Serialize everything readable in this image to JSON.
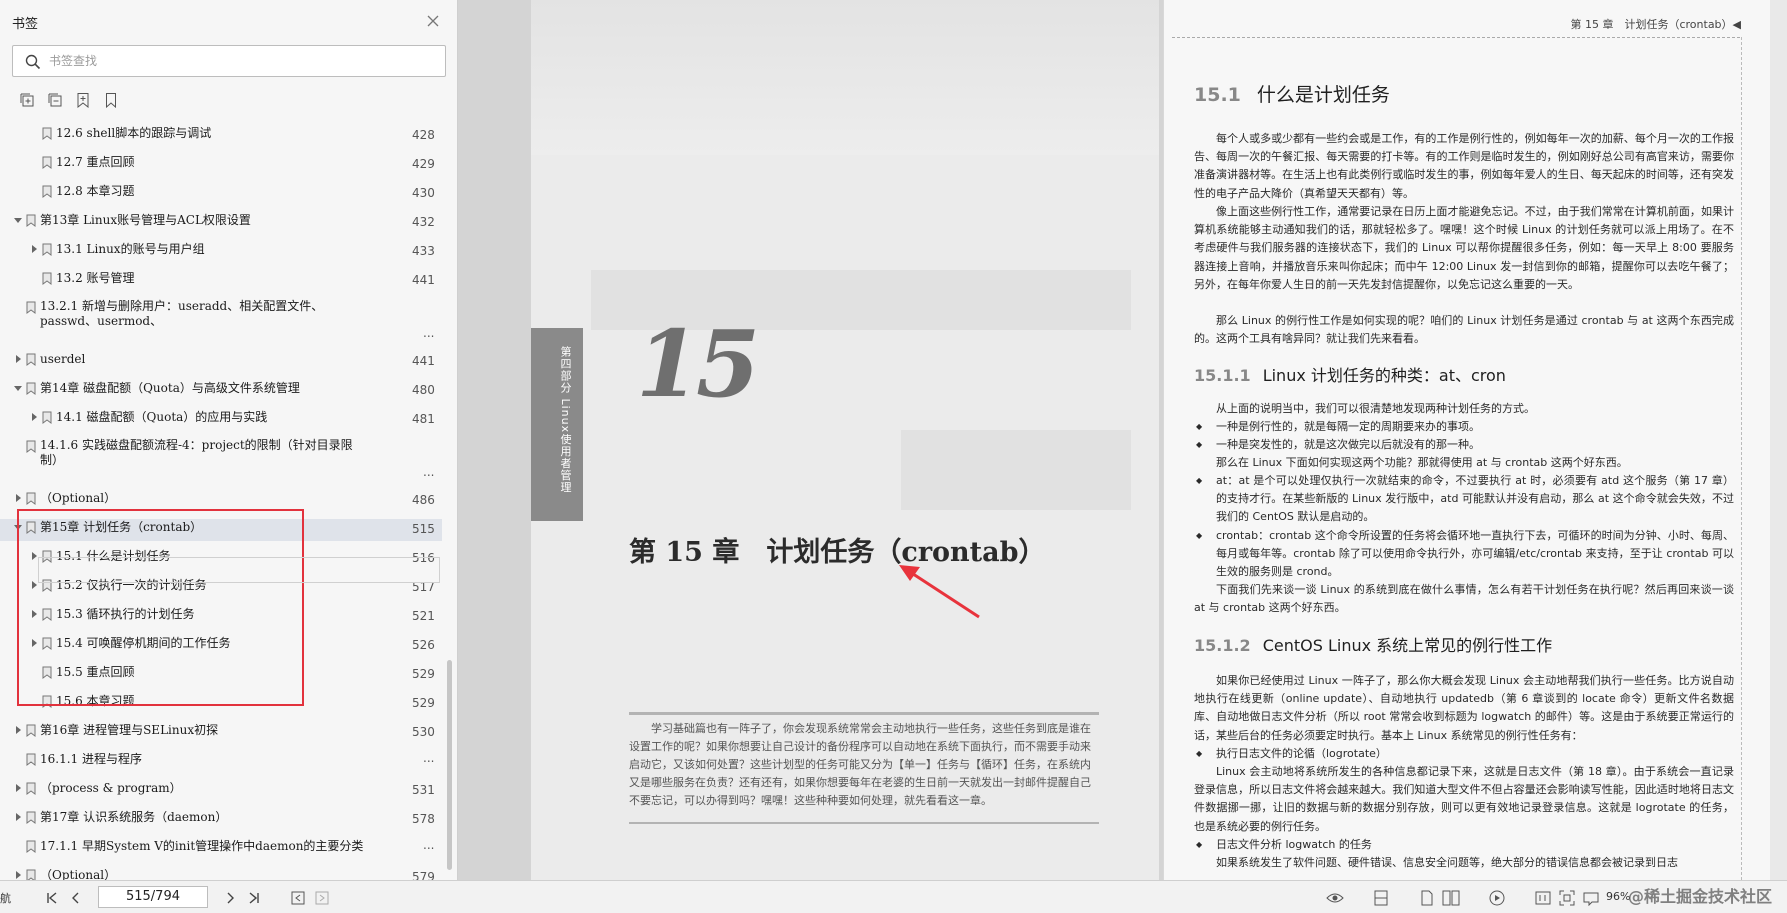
{
  "sidebar": {
    "title": "书签",
    "search_placeholder": "书签查找",
    "tree": [
      {
        "label": "12.6 shell脚本的跟踪与调试",
        "page": "428"
      },
      {
        "label": "12.7 重点回顾",
        "page": "429"
      },
      {
        "label": "12.8 本章习题",
        "page": "430"
      },
      {
        "label": "第13章 Linux账号管理与ACL权限设置",
        "page": "432"
      },
      {
        "label": "13.1 Linux的账号与用户组",
        "page": "433"
      },
      {
        "label": "13.2 账号管理",
        "page": "441"
      },
      {
        "label": "13.2.1 新增与删除用户：useradd、相关配置文件、passwd、usermod、",
        "page": "..."
      },
      {
        "label": "userdel",
        "page": "441"
      },
      {
        "label": "第14章 磁盘配额（Quota）与高级文件系统管理",
        "page": "480"
      },
      {
        "label": "14.1 磁盘配额（Quota）的应用与实践",
        "page": "481"
      },
      {
        "label": "14.1.6 实践磁盘配额流程-4：project的限制（针对目录限制）",
        "page": "..."
      },
      {
        "label": "（Optional）",
        "page": "486"
      },
      {
        "label": "第15章 计划任务（crontab）",
        "page": "515"
      },
      {
        "label": "15.1 什么是计划任务",
        "page": "516"
      },
      {
        "label": "15.2 仅执行一次的计划任务",
        "page": "517"
      },
      {
        "label": "15.3 循环执行的计划任务",
        "page": "521"
      },
      {
        "label": "15.4 可唤醒停机期间的工作任务",
        "page": "526"
      },
      {
        "label": "15.5 重点回顾",
        "page": "529"
      },
      {
        "label": "15.6 本章习题",
        "page": "529"
      },
      {
        "label": "第16章 进程管理与SELinux初探",
        "page": "530"
      },
      {
        "label": "16.1.1 进程与程序",
        "page": "..."
      },
      {
        "label": "（process & program）",
        "page": "531"
      },
      {
        "label": "第17章 认识系统服务（daemon）",
        "page": "578"
      },
      {
        "label": "17.1.1 早期System V的init管理操作中daemon的主要分类",
        "page": "..."
      },
      {
        "label": "（Optional）",
        "page": "579"
      }
    ]
  },
  "left_page": {
    "tab_text": "第四部分 Linux使用者管理",
    "chapter_number": "15",
    "chapter_title": "第 15 章　计划任务（crontab）",
    "intro": "学习基础篇也有一阵子了，你会发现系统常常会主动地执行一些任务，这些任务到底是谁在设置工作的呢？如果你想要让自己设计的备份程序可以自动地在系统下面执行，而不需要手动来启动它，又该如何处置？这些计划型的任务可能又分为【单一】任务与【循环】任务，在系统内又是哪些服务在负责？还有还有，如果你想要每年在老婆的生日前一天就发出一封邮件提醒自己不要忘记，可以办得到吗？嘿嘿！这些种种要如何处理，就先看看这一章。"
  },
  "right_page": {
    "header": "第 15 章　计划任务（crontab）◀",
    "h1_num": "15.1",
    "h1": "什么是计划任务",
    "p1": "每个人或多或少都有一些约会或是工作，有的工作是例行性的，例如每年一次的加薪、每个月一次的工作报告、每周一次的午餐汇报、每天需要的打卡等。有的工作则是临时发生的，例如刚好总公司有高官来访，需要你准备演讲器材等。在生活上也有此类例行或临时发生的事，例如每年爱人的生日、每天起床的时间等，还有突发性的电子产品大降价（真希望天天都有）等。",
    "p2": "像上面这些例行性工作，通常要记录在日历上面才能避免忘记。不过，由于我们常常在计算机前面，如果计算机系统能够主动通知我们的话，那就轻松多了。嘿嘿！这个时候 Linux 的计划任务就可以派上用场了。在不考虑硬件与我们服务器的连接状态下，我们的 Linux 可以帮你提醒很多任务，例如：每一天早上 8:00 要服务器连接上音响，并播放音乐来叫你起床；而中午 12:00 Linux 发一封信到你的邮箱，提醒你可以去吃午餐了；另外，在每年你爱人生日的前一天先发封信提醒你，以免忘记这么重要的一天。",
    "p3": "那么 Linux 的例行性工作是如何实现的呢？咱们的 Linux 计划任务是通过 crontab 与 at 这两个东西完成的。这两个工具有啥异同？就让我们先来看看。",
    "h2a_num": "15.1.1",
    "h2a": "Linux 计划任务的种类：at、cron",
    "p4": "从上面的说明当中，我们可以很清楚地发现两种计划任务的方式。",
    "b1": "一种是例行性的，就是每隔一定的周期要来办的事项。",
    "b2": "一种是突发性的，就是这次做完以后就没有的那一种。",
    "p5": "那么在 Linux 下面如何实现这两个功能？那就得使用 at 与 crontab 这两个好东西。",
    "b3": "at：at 是个可以处理仅执行一次就结束的命令，不过要执行 at 时，必须要有 atd 这个服务（第 17 章）的支持才行。在某些新版的 Linux 发行版中，atd 可能默认并没有启动，那么 at 这个命令就会失效，不过我们的 CentOS 默认是启动的。",
    "b4": "crontab：crontab 这个命令所设置的任务将会循环地一直执行下去，可循环的时间为分钟、小时、每周、每月或每年等。crontab 除了可以使用命令执行外，亦可编辑/etc/crontab 来支持，至于让 crontab 可以生效的服务则是 crond。",
    "p6": "下面我们先来谈一谈 Linux 的系统到底在做什么事情，怎么有若干计划任务在执行呢？然后再回来谈一谈 at 与 crontab 这两个好东西。",
    "h2b_num": "15.1.2",
    "h2b": "CentOS Linux 系统上常见的例行性工作",
    "p7": "如果你已经使用过 Linux 一阵子了，那么你大概会发现 Linux 会主动地帮我们执行一些任务。比方说自动地执行在线更新（online update）、自动地执行 updatedb（第 6 章谈到的 locate 命令）更新文件名数据库、自动地做日志文件分析（所以 root 常常会收到标题为 logwatch 的邮件）等。这是由于系统要正常运行的话，某些后台的任务必须要定时执行。基本上 Linux 系统常见的例行性任务有：",
    "b5": "执行日志文件的论循（logrotate）",
    "p8": "Linux 会主动地将系统所发生的各种信息都记录下来，这就是日志文件（第 18 章）。由于系统会一直记录登录信息，所以日志文件将会越来越大。我们知道大型文件不但占容量还会影响读写性能，因此适时地将日志文件数据挪一挪，让旧的数据与新的数据分别存放，则可以更有效地记录登录信息。这就是 logrotate 的任务，也是系统必要的例行任务。",
    "b6": "日志文件分析 logwatch 的任务",
    "p9": "如果系统发生了软件问题、硬件错误、信息安全问题等，绝大部分的错误信息都会被记录到日志"
  },
  "statusbar": {
    "left_text": "航",
    "page_field": "515/794",
    "zoom": "96%",
    "watermark": "@稀土掘金技术社区"
  }
}
